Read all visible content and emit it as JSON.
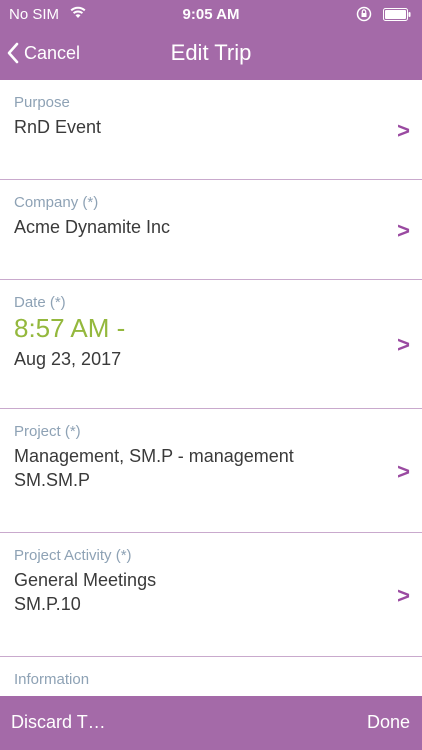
{
  "status": {
    "carrier": "No SIM",
    "time": "9:05 AM"
  },
  "nav": {
    "back_label": "Cancel",
    "title": "Edit Trip"
  },
  "fields": [
    {
      "label": "Purpose",
      "values": [
        "RnD Event"
      ]
    },
    {
      "label": "Company (*)",
      "values": [
        "Acme Dynamite Inc"
      ]
    },
    {
      "label": "Date (*)",
      "time": "8:57 AM -",
      "values": [
        "Aug 23, 2017"
      ]
    },
    {
      "label": "Project (*)",
      "values": [
        "Management, SM.P - management",
        "SM.SM.P"
      ]
    },
    {
      "label": "Project Activity (*)",
      "values": [
        "General Meetings",
        "SM.P.10"
      ]
    },
    {
      "label": "Information"
    }
  ],
  "toolbar": {
    "discard_label": "Discard T…",
    "done_label": "Done"
  },
  "chevron_glyph": ">",
  "colors": {
    "accent": "#a46aa8",
    "chevron": "#9a4aa1",
    "label": "#8ea2b5",
    "time": "#94b83d"
  }
}
